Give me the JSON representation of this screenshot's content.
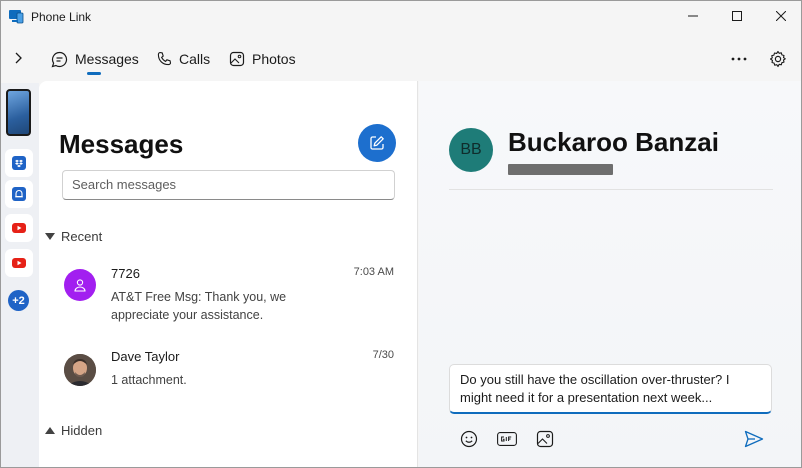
{
  "window": {
    "title": "Phone Link"
  },
  "nav": {
    "tabs": [
      {
        "label": "Messages",
        "icon": "chat-bubble-icon",
        "active": true
      },
      {
        "label": "Calls",
        "icon": "phone-icon",
        "active": false
      },
      {
        "label": "Photos",
        "icon": "photos-icon",
        "active": false
      }
    ],
    "more_label": "..."
  },
  "rail": {
    "apps": [
      "dropbox-icon",
      "notification-icon",
      "youtube-icon",
      "youtube-icon"
    ],
    "more_count": "+2"
  },
  "messages": {
    "heading": "Messages",
    "search_placeholder": "Search messages",
    "recent_label": "Recent",
    "hidden_label": "Hidden",
    "conversations": [
      {
        "name": "7726",
        "time": "7:03 AM",
        "preview": "AT&T Free Msg: Thank you, we appreciate your assistance."
      },
      {
        "name": "Dave Taylor",
        "time": "7/30",
        "preview": "1 attachment."
      }
    ]
  },
  "chat": {
    "contact_initials": "BB",
    "contact_name": "Buckaroo Banzai",
    "draft": "Do you still have the oscillation over-thruster? I might need it for a presentation next week..."
  },
  "colors": {
    "accent": "#0f6cbd",
    "compose_button": "#1d6fce",
    "contact_avatar": "#1e7c78",
    "sender_avatar": "#a21ff0"
  }
}
